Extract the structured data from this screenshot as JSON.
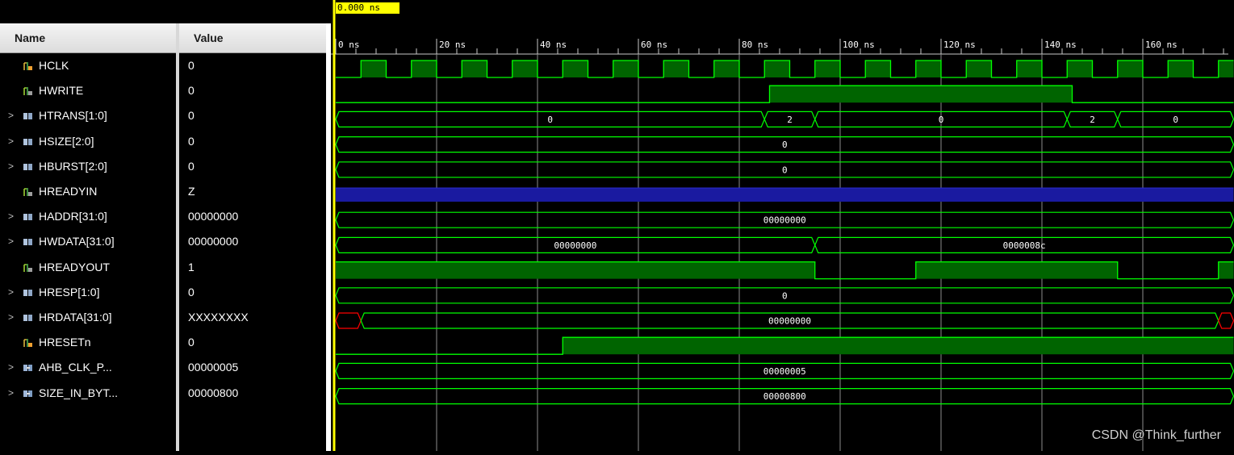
{
  "header": {
    "name_label": "Name",
    "value_label": "Value"
  },
  "cursor": {
    "time_label": "0.000 ns"
  },
  "timeline": {
    "tick_labels": [
      "0 ns",
      "20 ns",
      "40 ns",
      "60 ns",
      "80 ns",
      "100 ns",
      "120 ns",
      "140 ns",
      "160 ns"
    ]
  },
  "colors": {
    "wave": "#00ff00",
    "fill": "#006400",
    "highz": "#1a1aa0",
    "unknown": "#ff0000",
    "grid": "#8c8c8c",
    "cursor": "#ffff00"
  },
  "signals": [
    {
      "name": "HCLK",
      "value": "0",
      "kind": "bit",
      "expandable": false,
      "icon": "clock-bit-icon"
    },
    {
      "name": "HWRITE",
      "value": "0",
      "kind": "bit",
      "expandable": false,
      "icon": "bit-icon"
    },
    {
      "name": "HTRANS[1:0]",
      "value": "0",
      "kind": "bus",
      "expandable": true,
      "icon": "bus-icon",
      "bus_values": [
        "0",
        "2",
        "0",
        "2",
        "0"
      ]
    },
    {
      "name": "HSIZE[2:0]",
      "value": "0",
      "kind": "bus",
      "expandable": true,
      "icon": "bus-icon",
      "bus_values": [
        "0"
      ]
    },
    {
      "name": "HBURST[2:0]",
      "value": "0",
      "kind": "bus",
      "expandable": true,
      "icon": "bus-icon",
      "bus_values": [
        "0"
      ]
    },
    {
      "name": "HREADYIN",
      "value": "Z",
      "kind": "highz",
      "expandable": false,
      "icon": "bit-icon"
    },
    {
      "name": "HADDR[31:0]",
      "value": "00000000",
      "kind": "bus",
      "expandable": true,
      "icon": "bus-icon",
      "bus_values": [
        "00000000"
      ]
    },
    {
      "name": "HWDATA[31:0]",
      "value": "00000000",
      "kind": "bus",
      "expandable": true,
      "icon": "bus-icon",
      "bus_values": [
        "00000000",
        "0000008c"
      ]
    },
    {
      "name": "HREADYOUT",
      "value": "1",
      "kind": "bit",
      "expandable": false,
      "icon": "bit-icon"
    },
    {
      "name": "HRESP[1:0]",
      "value": "0",
      "kind": "bus",
      "expandable": true,
      "icon": "bus-icon",
      "bus_values": [
        "0"
      ]
    },
    {
      "name": "HRDATA[31:0]",
      "value": "XXXXXXXX",
      "kind": "bus",
      "expandable": true,
      "icon": "bus-icon",
      "bus_values": [
        "00000000"
      ]
    },
    {
      "name": "HRESETn",
      "value": "0",
      "kind": "bit",
      "expandable": false,
      "icon": "clock-bit-icon"
    },
    {
      "name": "AHB_CLK_P...",
      "value": "00000005",
      "kind": "bus",
      "expandable": true,
      "icon": "param-icon",
      "bus_values": [
        "00000005"
      ]
    },
    {
      "name": "SIZE_IN_BYT...",
      "value": "00000800",
      "kind": "bus",
      "expandable": true,
      "icon": "param-icon",
      "bus_values": [
        "00000800"
      ]
    }
  ],
  "watermark": "CSDN @Think_further"
}
